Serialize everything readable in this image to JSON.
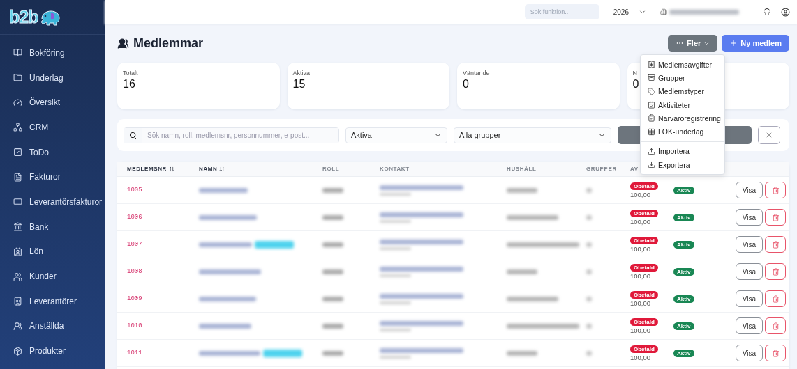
{
  "logo": "b2b",
  "sidebar": {
    "items": [
      {
        "label": "Bokföring"
      },
      {
        "label": "Underlag"
      },
      {
        "label": "Översikt"
      },
      {
        "label": "CRM"
      },
      {
        "label": "ToDo"
      },
      {
        "label": "Fakturor"
      },
      {
        "label": "Leverantörsfakturor"
      },
      {
        "label": "Bank"
      },
      {
        "label": "Lön"
      },
      {
        "label": "Kunder"
      },
      {
        "label": "Leverantörer"
      },
      {
        "label": "Anställda"
      },
      {
        "label": "Produkter"
      }
    ]
  },
  "topbar": {
    "search": {
      "placeholder": "Sök funktion..."
    },
    "year": "2026"
  },
  "page": {
    "title": "Medlemmar",
    "more_button": "Fler",
    "new_button": "Ny medlem"
  },
  "stats": [
    {
      "label": "Totalt",
      "value": "16"
    },
    {
      "label": "Aktiva",
      "value": "15"
    },
    {
      "label": "Väntande",
      "value": "0"
    },
    {
      "label": "N",
      "value": "0"
    }
  ],
  "filters": {
    "search": {
      "placeholder": "Sök namn, roll, medlemsnr, personnummer, e-post..."
    },
    "status": "Aktiva",
    "group": "Alla grupper"
  },
  "menu": {
    "items": [
      {
        "label": "Medlemsavgifter",
        "kind": "item"
      },
      {
        "label": "Grupper",
        "kind": "item"
      },
      {
        "label": "Medlemstyper",
        "kind": "item"
      },
      {
        "label": "Aktiviteter",
        "kind": "item"
      },
      {
        "label": "Närvaroregistrering",
        "kind": "item"
      },
      {
        "label": "LOK-underlag",
        "kind": "item"
      },
      {
        "kind": "divider"
      },
      {
        "label": "Importera",
        "kind": "item"
      },
      {
        "label": "Exportera",
        "kind": "item"
      }
    ]
  },
  "table": {
    "columns": [
      "MEDLEMSNR",
      "NAMN",
      "ROLL",
      "KONTAKT",
      "HUSHÅLL",
      "GRUPPER",
      "AV"
    ],
    "rows": [
      {
        "number": "1005",
        "tagged": false,
        "fee_status": "Obetald",
        "fee": "100,00",
        "status": "Aktiv",
        "view": "Visa"
      },
      {
        "number": "1006",
        "tagged": false,
        "fee_status": "Obetald",
        "fee": "100,00",
        "status": "Aktiv",
        "view": "Visa"
      },
      {
        "number": "1007",
        "tagged": true,
        "fee_status": "Obetald",
        "fee": "100,00",
        "status": "Aktiv",
        "view": "Visa"
      },
      {
        "number": "1008",
        "tagged": false,
        "fee_status": "Obetald",
        "fee": "100,00",
        "status": "Aktiv",
        "view": "Visa"
      },
      {
        "number": "1009",
        "tagged": false,
        "fee_status": "Obetald",
        "fee": "100,00",
        "status": "Aktiv",
        "view": "Visa"
      },
      {
        "number": "1010",
        "tagged": false,
        "fee_status": "Obetald",
        "fee": "100,00",
        "status": "Aktiv",
        "view": "Visa"
      },
      {
        "number": "1011",
        "tagged": true,
        "fee_status": "Obetald",
        "fee": "100,00",
        "status": "Aktiv",
        "view": "Visa"
      }
    ]
  }
}
